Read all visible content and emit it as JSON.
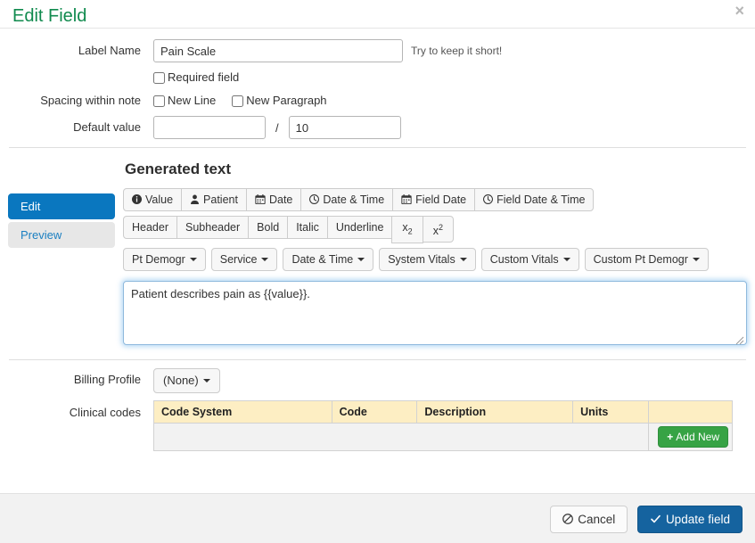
{
  "header": {
    "title": "Edit Field",
    "close_label": "×"
  },
  "form": {
    "label_name": {
      "label": "Label Name",
      "value": "Pain Scale",
      "hint": "Try to keep it short!"
    },
    "required_field": {
      "label": "Required field",
      "checked": false
    },
    "spacing": {
      "label": "Spacing within note",
      "new_line": {
        "label": "New Line",
        "checked": false
      },
      "new_paragraph": {
        "label": "New Paragraph",
        "checked": false
      }
    },
    "default_value": {
      "label": "Default value",
      "value": "",
      "separator": "/",
      "max_value": "10"
    }
  },
  "generated_text": {
    "title": "Generated text",
    "tabs": [
      {
        "label": "Edit",
        "active": true
      },
      {
        "label": "Preview",
        "active": false
      }
    ],
    "insert_buttons": [
      {
        "label": "Value",
        "icon": "info-circle-icon"
      },
      {
        "label": "Patient",
        "icon": "user-icon"
      },
      {
        "label": "Date",
        "icon": "calendar-icon"
      },
      {
        "label": "Date & Time",
        "icon": "clock-icon"
      },
      {
        "label": "Field Date",
        "icon": "calendar-icon"
      },
      {
        "label": "Field Date & Time",
        "icon": "clock-icon"
      }
    ],
    "format_buttons": [
      {
        "label": "Header"
      },
      {
        "label": "Subheader"
      },
      {
        "label": "Bold"
      },
      {
        "label": "Italic"
      },
      {
        "label": "Underline"
      },
      {
        "label": "x2",
        "style": "subscript"
      },
      {
        "label": "x2",
        "style": "superscript"
      }
    ],
    "dropdown_buttons": [
      {
        "label": "Pt Demogr"
      },
      {
        "label": "Service"
      },
      {
        "label": "Date & Time"
      },
      {
        "label": "System Vitals"
      },
      {
        "label": "Custom Vitals"
      },
      {
        "label": "Custom Pt Demogr"
      }
    ],
    "content": "Patient describes pain as {{value}}."
  },
  "billing": {
    "label": "Billing Profile",
    "selected": "(None)"
  },
  "clinical_codes": {
    "label": "Clinical codes",
    "columns": [
      "Code System",
      "Code",
      "Description",
      "Units",
      ""
    ],
    "rows": [],
    "add_new_label": "Add New",
    "add_new_plus": "+"
  },
  "footer": {
    "cancel_label": "Cancel",
    "submit_label": "Update field"
  },
  "colors": {
    "title_green": "#108a4e",
    "primary_blue": "#15639f",
    "tab_blue": "#0a77bf",
    "add_green": "#37a345",
    "table_header": "#fdeec3"
  }
}
